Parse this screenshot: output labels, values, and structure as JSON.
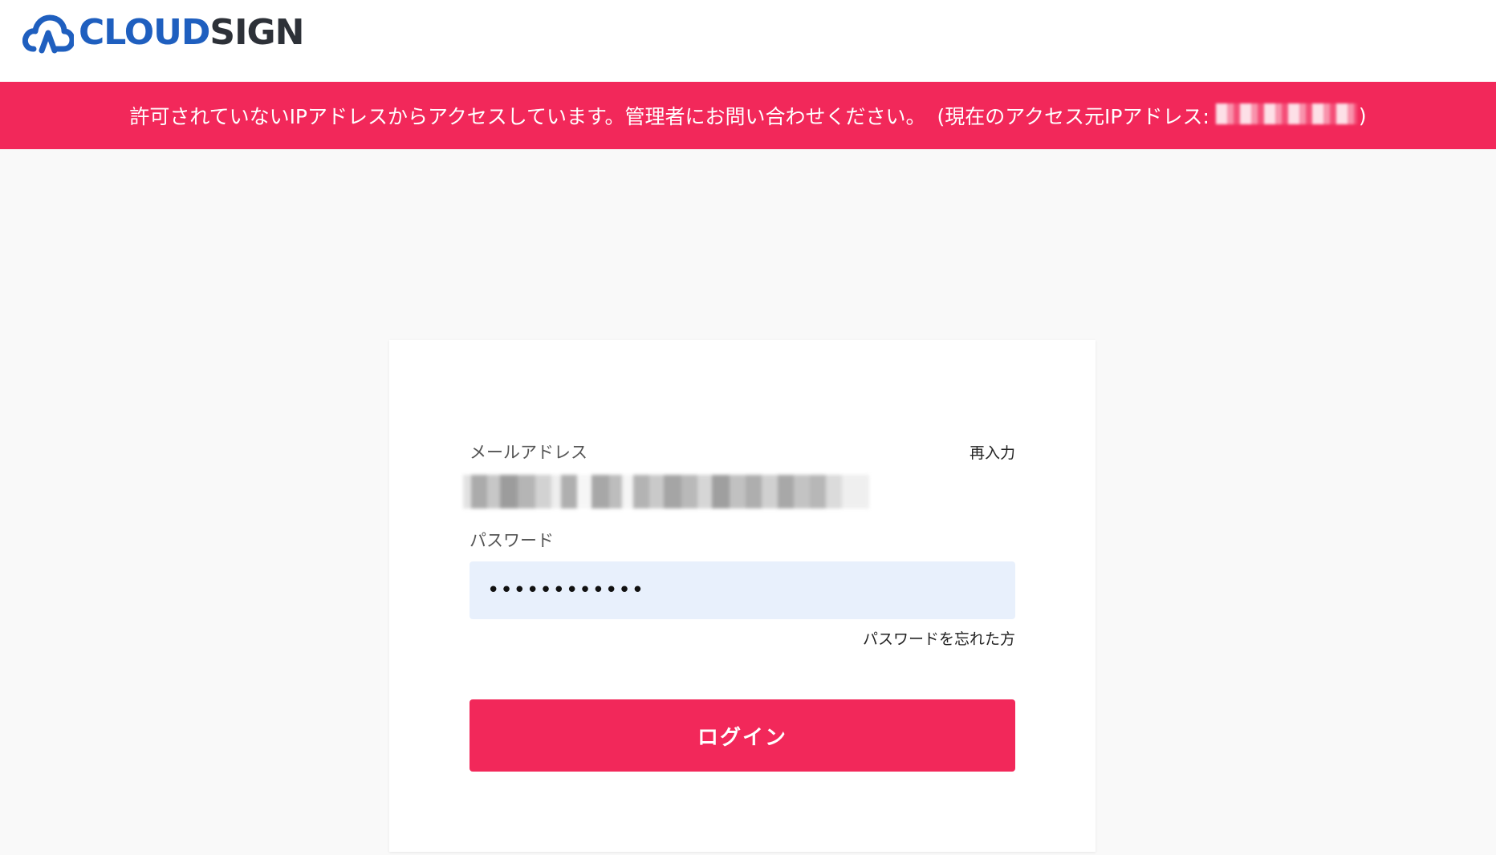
{
  "brand": {
    "part1": "CLOUD",
    "part2": "SIGN",
    "colors": {
      "blue": "#1f5fbf",
      "dark": "#2d3138"
    }
  },
  "alert": {
    "message": "許可されていないIPアドレスからアクセスしています。管理者にお問い合わせください。",
    "ip_prefix": "(現在のアクセス元IPアドレス:",
    "ip_suffix": ")",
    "background": "#f2285a"
  },
  "form": {
    "email_label": "メールアドレス",
    "reenter_link": "再入力",
    "password_label": "パスワード",
    "password_value": "••••••••••••",
    "forgot_link": "パスワードを忘れた方",
    "login_button": "ログイン"
  },
  "icons": {
    "logo": "cloud-upload-icon"
  }
}
